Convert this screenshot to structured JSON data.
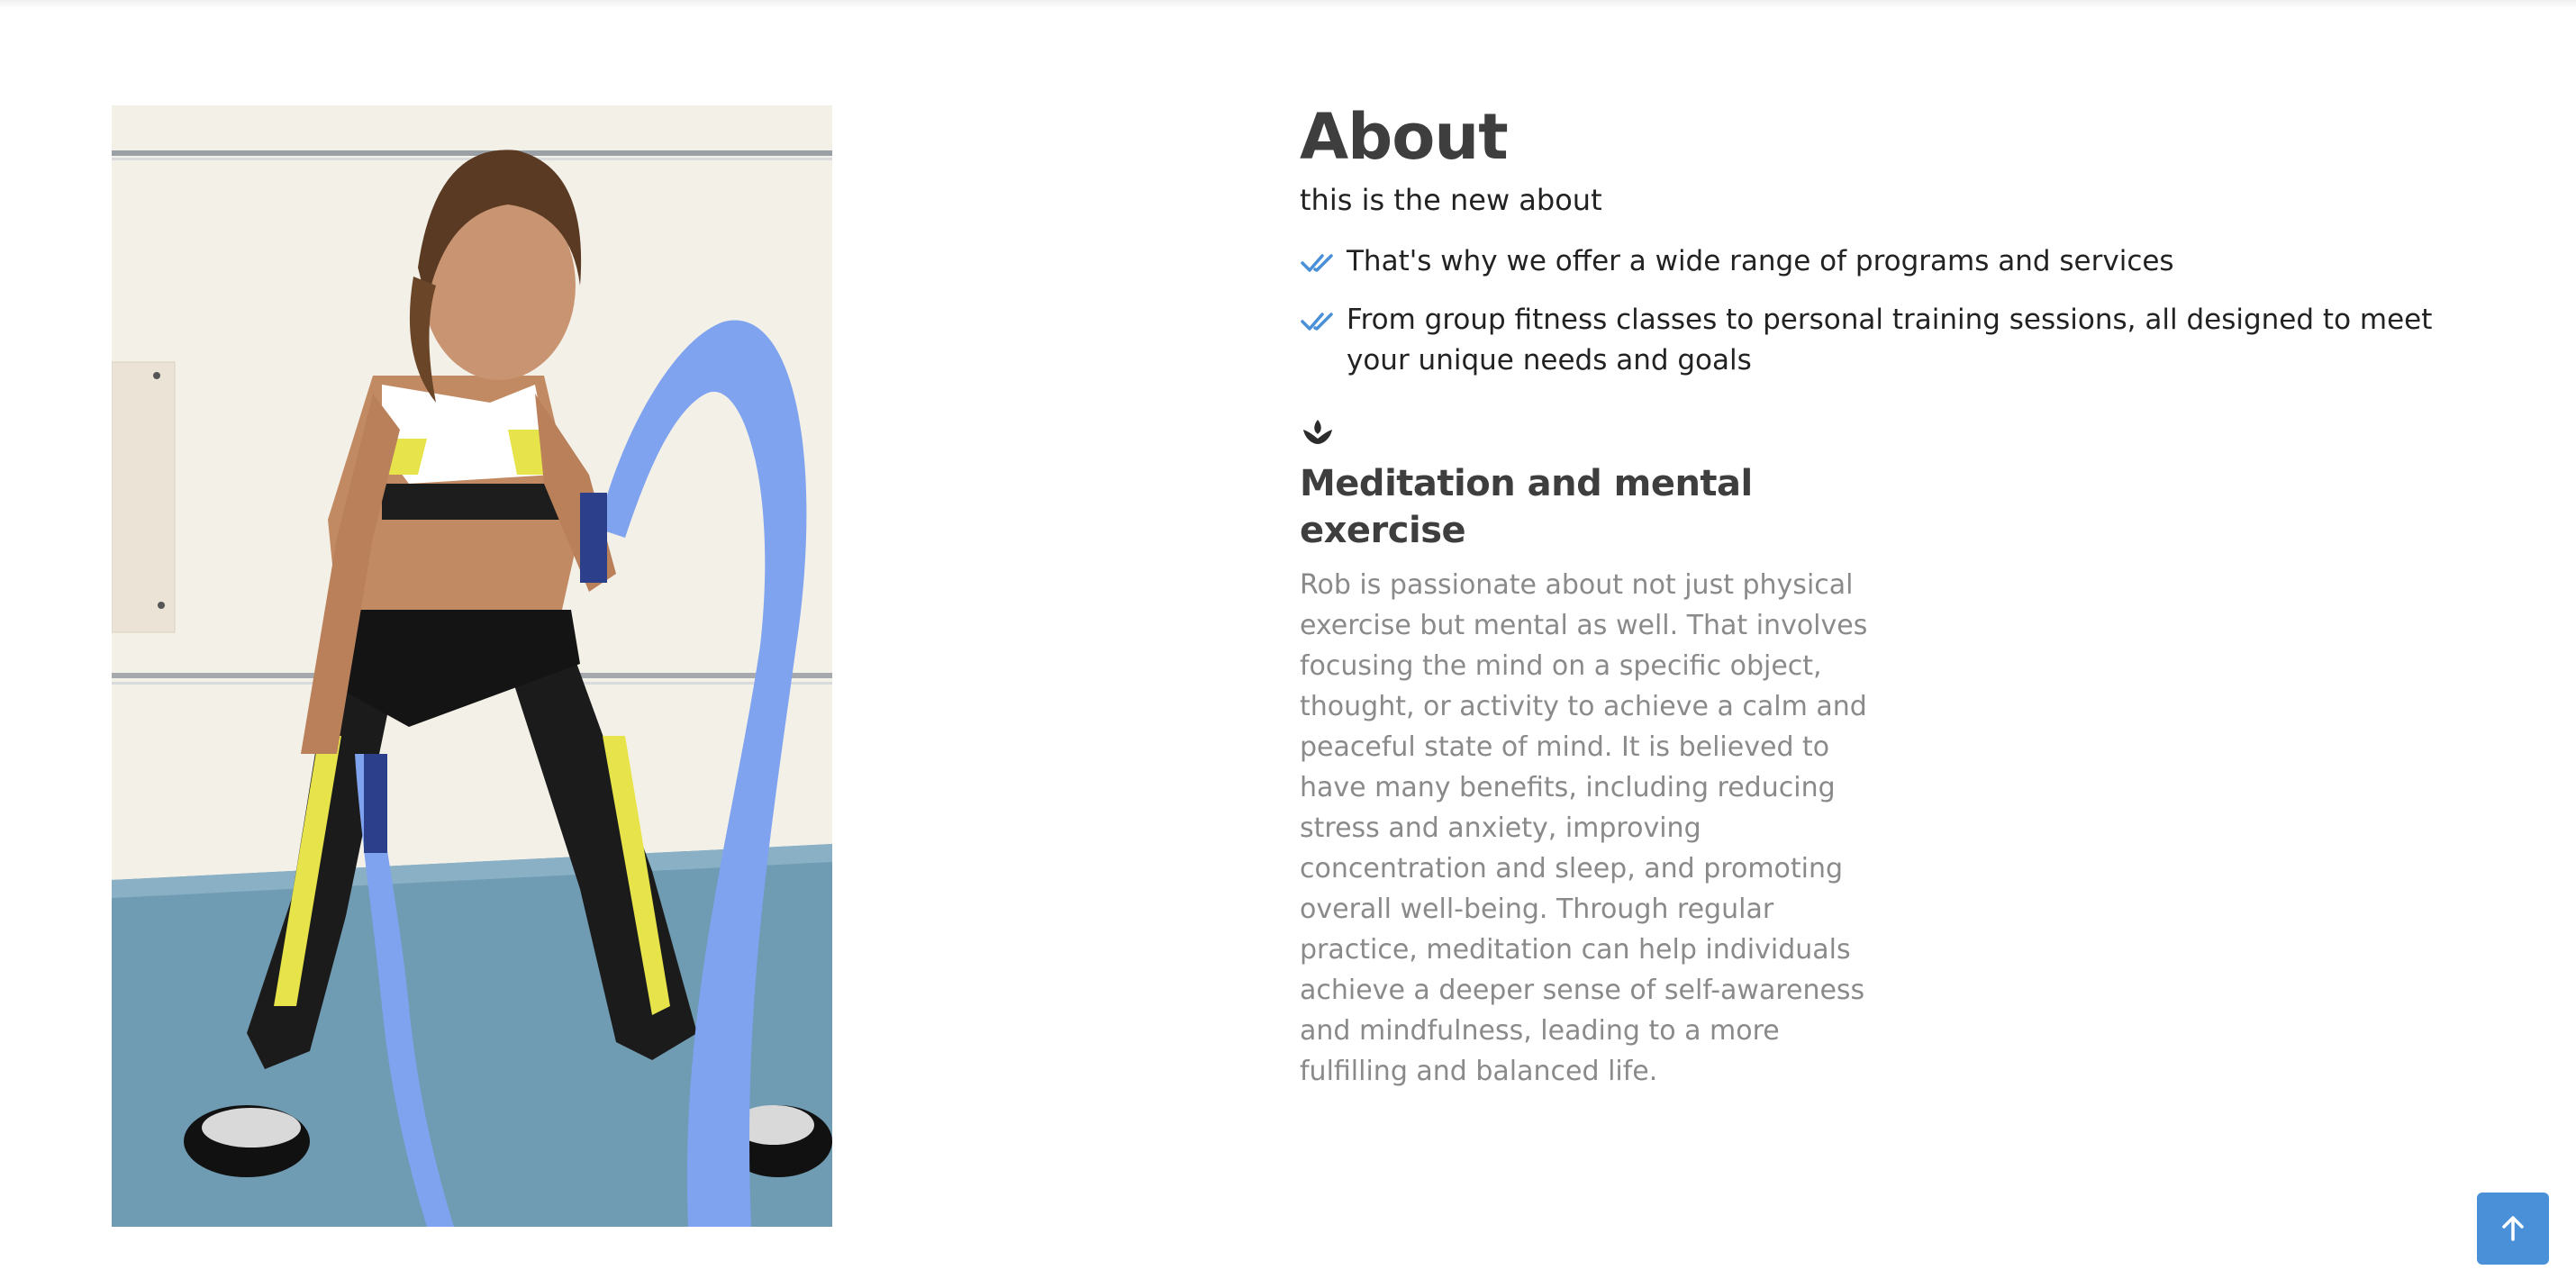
{
  "about": {
    "title": "About",
    "subtitle": "this is the new about",
    "points": [
      "That's why we offer a wide range of programs and services",
      "From group fitness classes to personal training sessions, all designed to meet your unique needs and goals"
    ]
  },
  "feature": {
    "icon": "lotus-icon",
    "title": "Meditation and mental exercise",
    "text": "Rob is passionate about not just physical exercise but mental as well. That involves focusing the mind on a specific object, thought, or activity to achieve a calm and peaceful state of mind. It is believed to have many benefits, including reducing stress and anxiety, improving concentration and sleep, and promoting overall well-being. Through regular practice, meditation can help individuals achieve a deeper sense of self-awareness and mindfulness, leading to a more fulfilling and balanced life."
  },
  "icons": {
    "check": "double-check-icon",
    "back_to_top": "arrow-up-icon"
  },
  "colors": {
    "accent": "#4a90d9",
    "heading": "#3e3e3e",
    "body_muted": "#8a8a8a"
  }
}
